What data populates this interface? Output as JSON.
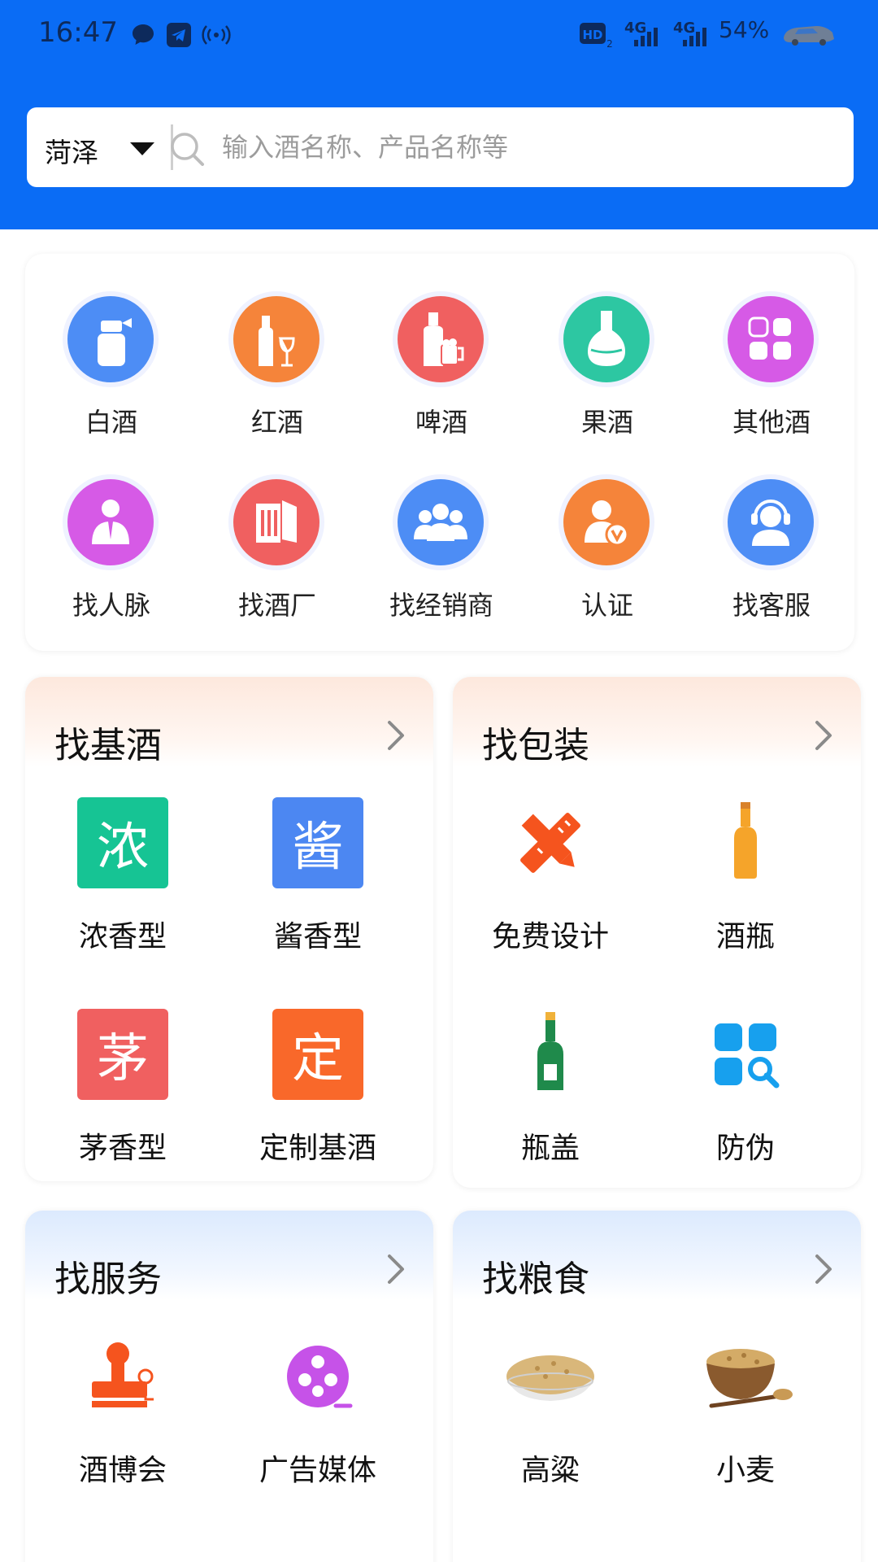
{
  "status_bar": {
    "time": "16:47",
    "battery": "54%",
    "network1": "4G",
    "network2": "4G",
    "hd_label": "HD"
  },
  "search": {
    "city": "菏泽",
    "placeholder": "输入酒名称、产品名称等"
  },
  "categories": [
    {
      "label": "白酒",
      "icon": "baijiu-bottle-icon",
      "color": "#4d8df5"
    },
    {
      "label": "红酒",
      "icon": "wine-bottle-glass-icon",
      "color": "#f5843a"
    },
    {
      "label": "啤酒",
      "icon": "beer-bottle-mug-icon",
      "color": "#f06060"
    },
    {
      "label": "果酒",
      "icon": "fruit-wine-bottle-icon",
      "color": "#2dc7a2"
    },
    {
      "label": "其他酒",
      "icon": "grid-apps-icon",
      "color": "#d65ae6"
    },
    {
      "label": "找人脉",
      "icon": "person-tie-icon",
      "color": "#d65ae6"
    },
    {
      "label": "找酒厂",
      "icon": "factory-book-icon",
      "color": "#f06060"
    },
    {
      "label": "找经销商",
      "icon": "group-people-icon",
      "color": "#4d8df5"
    },
    {
      "label": "认证",
      "icon": "verified-user-icon",
      "color": "#f5843a"
    },
    {
      "label": "找客服",
      "icon": "headset-agent-icon",
      "color": "#4d8df5"
    }
  ],
  "sections": {
    "base_liquor": {
      "title": "找基酒",
      "items": [
        {
          "label": "浓香型",
          "char": "浓",
          "color": "#16c494"
        },
        {
          "label": "酱香型",
          "char": "酱",
          "color": "#4c87f2"
        },
        {
          "label": "茅香型",
          "char": "茅",
          "color": "#f06060"
        },
        {
          "label": "定制基酒",
          "char": "定",
          "color": "#f9682a"
        }
      ]
    },
    "packaging": {
      "title": "找包装",
      "items": [
        {
          "label": "免费设计",
          "icon": "ruler-pencil-icon"
        },
        {
          "label": "酒瓶",
          "icon": "bottle-icon"
        },
        {
          "label": "瓶盖",
          "icon": "green-bottle-icon"
        },
        {
          "label": "防伪",
          "icon": "grid-search-icon"
        }
      ]
    },
    "services": {
      "title": "找服务",
      "items": [
        {
          "label": "酒博会",
          "icon": "stamp-icon"
        },
        {
          "label": "广告媒体",
          "icon": "film-reel-icon"
        }
      ]
    },
    "grain": {
      "title": "找粮食",
      "items": [
        {
          "label": "高粱",
          "icon": "sorghum-bowl-icon"
        },
        {
          "label": "小麦",
          "icon": "wheat-bowl-icon"
        }
      ]
    }
  }
}
